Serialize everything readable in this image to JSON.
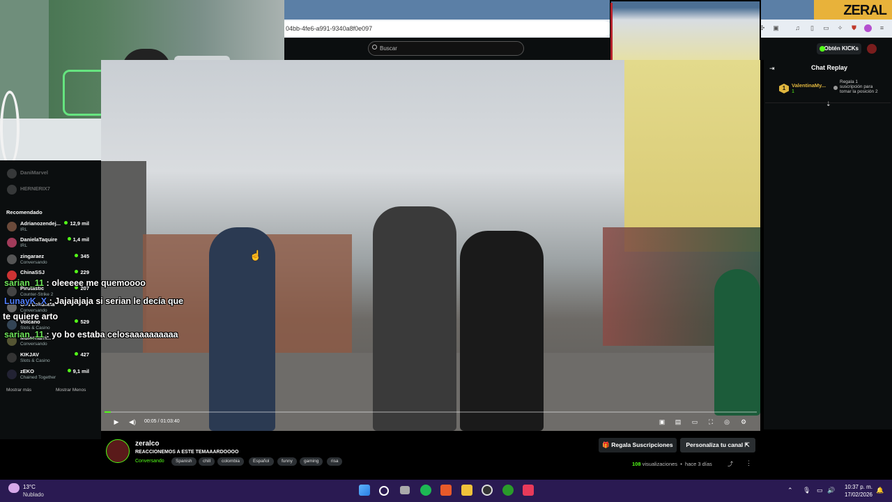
{
  "browser": {
    "url": "04bb-4fe6-a991-9340a8f0e097"
  },
  "kick": {
    "search_placeholder": "Buscar",
    "get_kicks_label": "Obtén KICKs"
  },
  "overlay_logo": "ZERAL",
  "sidebar": {
    "following": [
      {
        "name": "DaniMarvel"
      },
      {
        "name": "HERNERIX7"
      }
    ],
    "recommended_title": "Recomendado",
    "recommended": [
      {
        "name": "Adrianozendej...",
        "category": "IRL",
        "viewers": "12,9 mil",
        "color": "#6b4a3a"
      },
      {
        "name": "DanielaTaquire",
        "category": "IRL",
        "viewers": "1,4 mil",
        "color": "#a23b5a"
      },
      {
        "name": "zingaraez",
        "category": "Conversando",
        "viewers": "345",
        "color": "#555"
      },
      {
        "name": "ChinaSSJ",
        "category": "",
        "viewers": "229",
        "color": "#c33"
      },
      {
        "name": "Pirutastic",
        "category": "Counter-Strike 2",
        "viewers": "207",
        "color": "#444"
      },
      {
        "name": "Gus Lokuneia",
        "category": "Conversando",
        "viewers": "",
        "color": "#666"
      },
      {
        "name": "Volcano",
        "category": "Slots & Casino",
        "viewers": "529",
        "color": "#345"
      },
      {
        "name": "Mulacharri...",
        "category": "Conversando",
        "viewers": "",
        "color": "#553"
      },
      {
        "name": "KIKJAV",
        "category": "Slots & Casino",
        "viewers": "427",
        "color": "#333"
      },
      {
        "name": "zEKO",
        "category": "Chained Together",
        "viewers": "9,1 mil",
        "color": "#223"
      }
    ],
    "show_more": "Mostrar más",
    "show_less": "Mostrar Menos"
  },
  "overlay_chat": [
    {
      "user": "sarian_11",
      "user_color": "#6ee35a",
      "text": ": oleeeee me quemoooo"
    },
    {
      "user": "LunayK_X",
      "user_color": "#4f7df7",
      "text": ": Jajajajaja si serian le decía que"
    },
    {
      "user": "",
      "user_color": "#fff",
      "text": "te quiere arto"
    },
    {
      "user": "sarian_11",
      "user_color": "#6ee35a",
      "text": ": yo bo estaba celosaaaaaaaaaa"
    }
  ],
  "player": {
    "timecode": "00:05 / 01:03:40",
    "progress_fraction": 0.0013
  },
  "chat": {
    "title": "Chat Replay",
    "pinned_user": "ValentinaMy...",
    "pinned_count": "1",
    "pinned_badge": "1",
    "gift_prompt": "Regala 1 suscripción para tomar la posición 2"
  },
  "stream": {
    "streamer": "zeralco",
    "title": "REACCIONEMOS A ESTE TEMAAARDOOOO",
    "category": "Conversando",
    "tags": [
      "Spanish",
      "chill",
      "colombia",
      "Español",
      "funny",
      "gaming",
      "risa"
    ],
    "gift_subs_label": "Regala Suscripciones",
    "customize_label": "Personaliza tu canal",
    "views_count": "108",
    "views_label": "visualizaciones",
    "age": "hace 3 días"
  },
  "taskbar": {
    "temp": "13°C",
    "weather": "Nublado",
    "time": "10:37 p. m.",
    "date": "17/02/2026"
  }
}
